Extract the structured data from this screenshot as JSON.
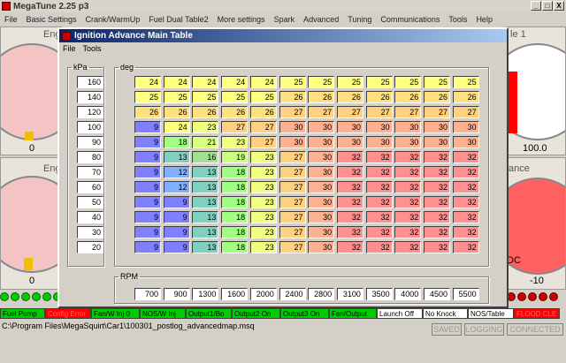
{
  "app": {
    "title": "MegaTune 2.25 p3",
    "menus": [
      "File",
      "Basic Settings",
      "Crank/WarmUp",
      "Fuel Dual Table2",
      "More settings",
      "Spark",
      "Advanced",
      "Tuning",
      "Communications",
      "Tools",
      "Help"
    ],
    "min_glyph": "_",
    "max_glyph": "□",
    "close_glyph": "X"
  },
  "gauges": {
    "left_top_label": "Eng",
    "left_top_value": "0",
    "right_top_label": "le 1",
    "right_top_value": "100.0",
    "left_bottom_label": "Eng",
    "left_bottom_value": "0",
    "right_bottom_label": "ance",
    "right_bottom_value": "-10",
    "right_bottom_unit": "DC"
  },
  "dialog": {
    "title": "Ignition Advance Main Table",
    "menus": [
      "File",
      "Tools"
    ],
    "kpa_label": "kPa",
    "deg_label": "deg",
    "rpm_label": "RPM",
    "kpa": [
      "160",
      "140",
      "120",
      "100",
      "90",
      "80",
      "70",
      "60",
      "50",
      "40",
      "30",
      "20"
    ],
    "rpm": [
      "700",
      "900",
      "1300",
      "1600",
      "2000",
      "2400",
      "2800",
      "3100",
      "3500",
      "4000",
      "4500",
      "5500"
    ],
    "table": [
      [
        "24",
        "24",
        "24",
        "24",
        "24",
        "25",
        "25",
        "25",
        "25",
        "25",
        "25",
        "25"
      ],
      [
        "25",
        "25",
        "25",
        "25",
        "25",
        "26",
        "26",
        "26",
        "26",
        "26",
        "26",
        "26"
      ],
      [
        "26",
        "26",
        "26",
        "26",
        "26",
        "27",
        "27",
        "27",
        "27",
        "27",
        "27",
        "27"
      ],
      [
        "9",
        "24",
        "23",
        "27",
        "27",
        "30",
        "30",
        "30",
        "30",
        "30",
        "30",
        "30"
      ],
      [
        "9",
        "18",
        "21",
        "23",
        "27",
        "30",
        "30",
        "30",
        "30",
        "30",
        "30",
        "30"
      ],
      [
        "9",
        "13",
        "16",
        "19",
        "23",
        "27",
        "30",
        "32",
        "32",
        "32",
        "32",
        "32"
      ],
      [
        "9",
        "12",
        "13",
        "18",
        "23",
        "27",
        "30",
        "32",
        "32",
        "32",
        "32",
        "32"
      ],
      [
        "9",
        "12",
        "13",
        "18",
        "23",
        "27",
        "30",
        "32",
        "32",
        "32",
        "32",
        "32"
      ],
      [
        "9",
        "9",
        "13",
        "18",
        "23",
        "27",
        "30",
        "32",
        "32",
        "32",
        "32",
        "32"
      ],
      [
        "9",
        "9",
        "13",
        "18",
        "23",
        "27",
        "30",
        "32",
        "32",
        "32",
        "32",
        "32"
      ],
      [
        "9",
        "9",
        "13",
        "18",
        "23",
        "27",
        "30",
        "32",
        "32",
        "32",
        "32",
        "32"
      ],
      [
        "9",
        "9",
        "13",
        "18",
        "23",
        "27",
        "30",
        "32",
        "32",
        "32",
        "32",
        "32"
      ]
    ]
  },
  "status": [
    {
      "text": "Fuel Pump",
      "bg": "#00cc00",
      "fg": "#000000"
    },
    {
      "text": "Config Error",
      "bg": "#ff0000",
      "fg": "#ff6666"
    },
    {
      "text": "Fan/W Inj 0",
      "bg": "#00cc00",
      "fg": "#000000"
    },
    {
      "text": "NOS/W Inj",
      "bg": "#00cc00",
      "fg": "#000000"
    },
    {
      "text": "Output1/Bo",
      "bg": "#00cc00",
      "fg": "#000000"
    },
    {
      "text": "Output2 On",
      "bg": "#00cc00",
      "fg": "#000000"
    },
    {
      "text": "Output3 On",
      "bg": "#00cc00",
      "fg": "#000000"
    },
    {
      "text": "Fan/Output",
      "bg": "#00cc00",
      "fg": "#000000"
    },
    {
      "text": "Launch Off",
      "bg": "#ffffff",
      "fg": "#000000"
    },
    {
      "text": "No Knock",
      "bg": "#ffffff",
      "fg": "#000000"
    },
    {
      "text": "NOS/Table",
      "bg": "#ffffff",
      "fg": "#000000"
    },
    {
      "text": "FLOOD CLE",
      "bg": "#ff0000",
      "fg": "#ff6666"
    }
  ],
  "path": "C:\\Program Files\\MegaSquirt\\Car1\\100301_postlog_advancedmap.msq",
  "right_status": [
    "SAVED",
    "LOGGING",
    "CONNECTED"
  ],
  "colors": {
    "v9": "#8080ff",
    "v12": "#80b0ff",
    "v13": "#80d0c0",
    "v16": "#a0e090",
    "v18": "#a0ff80",
    "v19": "#c8ff80",
    "v21": "#d8ff80",
    "v23": "#f0ff80",
    "v24": "#ffff80",
    "v25": "#ffff80",
    "v26": "#ffe080",
    "v27": "#ffd080",
    "v30": "#ffb090",
    "v32": "#ff9090"
  }
}
